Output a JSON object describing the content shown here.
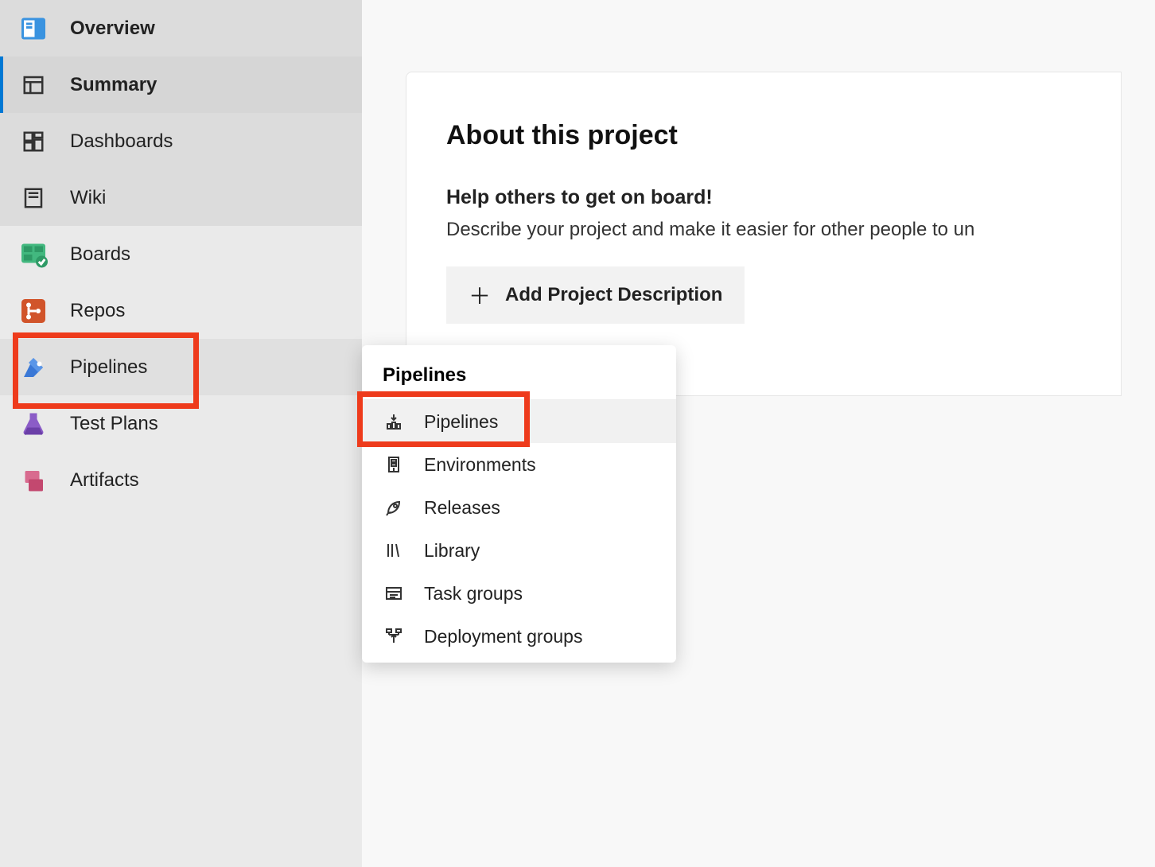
{
  "sidebar": {
    "overview": "Overview",
    "summary": "Summary",
    "dashboards": "Dashboards",
    "wiki": "Wiki",
    "boards": "Boards",
    "repos": "Repos",
    "pipelines": "Pipelines",
    "testplans": "Test Plans",
    "artifacts": "Artifacts"
  },
  "flyout": {
    "title": "Pipelines",
    "items": {
      "pipelines": "Pipelines",
      "environments": "Environments",
      "releases": "Releases",
      "library": "Library",
      "taskgroups": "Task groups",
      "deploygroups": "Deployment groups"
    }
  },
  "about": {
    "heading": "About this project",
    "subheading": "Help others to get on board!",
    "description": "Describe your project and make it easier for other people to un",
    "addbtn": "Add Project Description"
  }
}
